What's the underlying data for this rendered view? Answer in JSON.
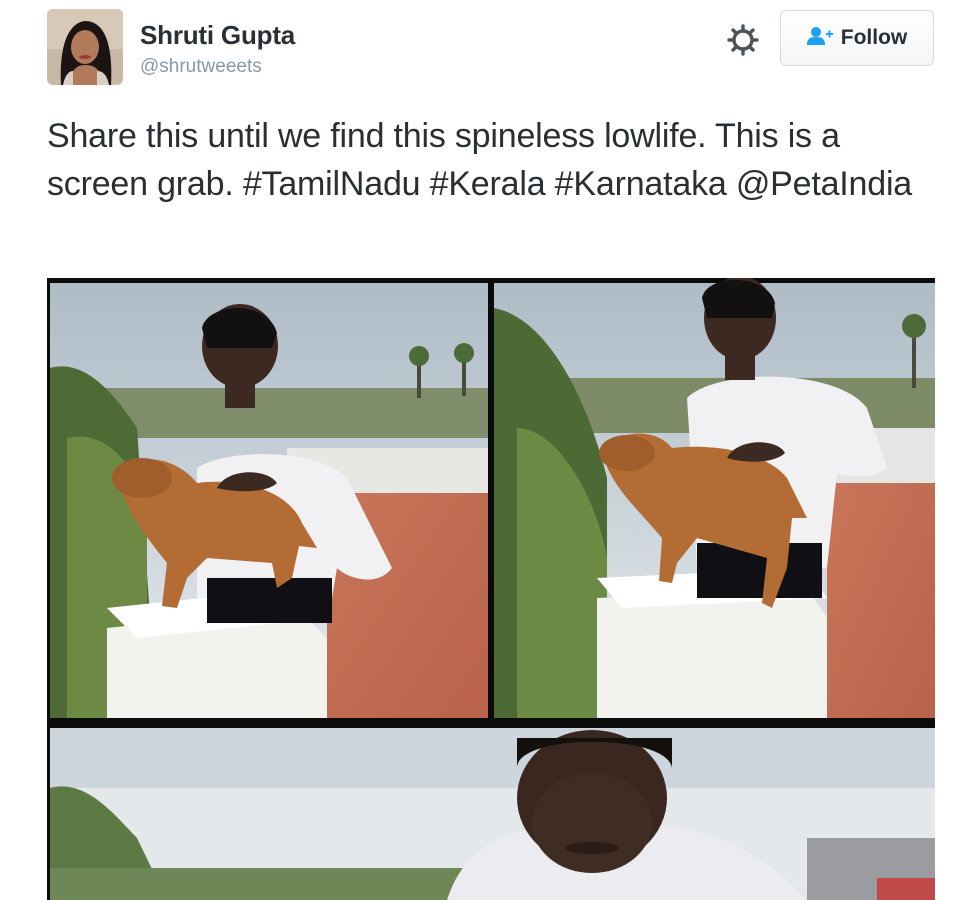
{
  "user": {
    "display_name": "Shruti Gupta",
    "handle": "@shrutweeets"
  },
  "actions": {
    "settings_icon": "gear-icon",
    "follow_icon": "add-user-icon",
    "follow_label": "Follow"
  },
  "tweet": {
    "text_before": "Share this until we find this spineless lowlife. This is a screen grab. ",
    "hashtags": [
      "#TamilNadu",
      "#Kerala",
      "#Karnataka"
    ],
    "mention": "@PetaIndia"
  },
  "colors": {
    "text": "#292f33",
    "muted": "#8899a6",
    "follow_icon": "#1da1f2"
  }
}
